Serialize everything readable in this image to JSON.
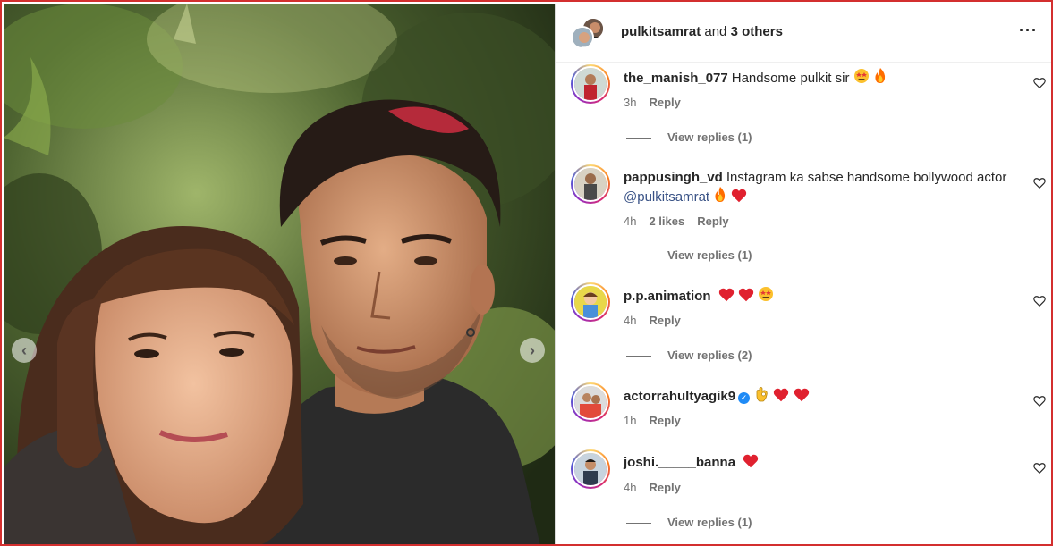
{
  "photo": {
    "prev_label": "‹",
    "next_label": "›"
  },
  "header": {
    "username": "pulkitsamrat",
    "connector": "and",
    "others": "3 others",
    "more_label": "···"
  },
  "comments": [
    {
      "username": "the_manish_077",
      "text": "Handsome pulkit sir",
      "emojis": [
        "star-struck",
        "fire"
      ],
      "time": "3h",
      "likes": "",
      "reply_label": "Reply",
      "view_replies": "View replies (1)"
    },
    {
      "username": "pappusingh_vd",
      "text": "Instagram ka sabse handsome bollywood actor",
      "mention": "@pulkitsamrat",
      "emojis": [
        "fire",
        "red-heart"
      ],
      "time": "4h",
      "likes": "2 likes",
      "reply_label": "Reply",
      "view_replies": "View replies (1)"
    },
    {
      "username": "p.p.animation",
      "text": "",
      "emojis": [
        "red-heart",
        "red-heart",
        "star-struck"
      ],
      "time": "4h",
      "likes": "",
      "reply_label": "Reply",
      "view_replies": "View replies (2)"
    },
    {
      "username": "actorrahultyagik9",
      "verified": true,
      "text": "",
      "emojis": [
        "ok-hand",
        "red-heart",
        "red-heart"
      ],
      "time": "1h",
      "likes": "",
      "reply_label": "Reply",
      "view_replies": ""
    },
    {
      "username": "joshi._____banna",
      "text": "",
      "emojis": [
        "red-heart"
      ],
      "time": "4h",
      "likes": "",
      "reply_label": "Reply",
      "view_replies": "View replies (1)"
    }
  ],
  "colors": {
    "border": "#d32f2f",
    "mention": "#385185",
    "muted": "#737373",
    "verified": "#1f8bf6"
  }
}
